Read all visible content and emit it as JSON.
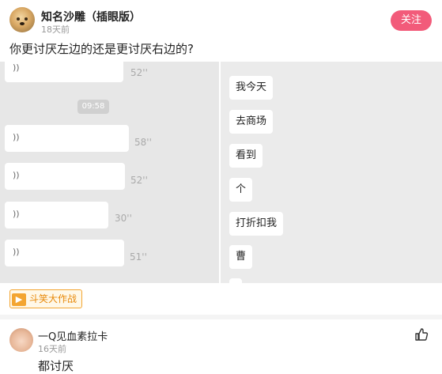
{
  "post": {
    "author": "知名沙雕（插眼版）",
    "time": "18天前",
    "follow_label": "关注",
    "question": "你更讨厌左边的还是更讨厌右边的?"
  },
  "image": {
    "left_panel": {
      "time_divider": "09:58",
      "voice_icon": "))",
      "voice_messages": [
        {
          "duration": "52''"
        },
        {
          "duration": "58''"
        },
        {
          "duration": "52''"
        },
        {
          "duration": "30''"
        },
        {
          "duration": "51''"
        }
      ]
    },
    "right_panel": {
      "messages": [
        "我今天",
        "去商场",
        "看到",
        "个",
        "打折扣我",
        "曹"
      ]
    }
  },
  "topic": {
    "icon": "megaphone-icon",
    "label": "斗笑大作战"
  },
  "comment": {
    "user": "一Q见血素拉卡",
    "time": "16天前",
    "text": "都讨厌"
  },
  "colors": {
    "accent": "#f25b7a",
    "topic": "#f3a531"
  }
}
